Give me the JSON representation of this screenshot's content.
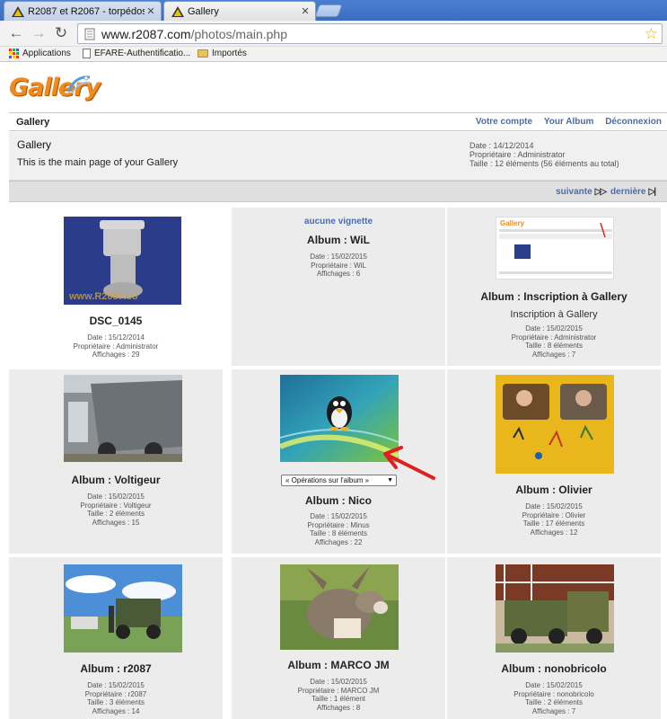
{
  "browser": {
    "tabs": [
      {
        "title": "R2087 et R2067 - torpédos,",
        "active": false
      },
      {
        "title": "Gallery",
        "active": true
      }
    ],
    "url_host": "www.r2087.com",
    "url_path": "/photos/main.php",
    "bookmarks": [
      "Applications",
      "EFARE-Authentificatio...",
      "Importés"
    ]
  },
  "gallery": {
    "logo_text": "Gallery",
    "breadcrumb": "Gallery",
    "links": {
      "account": "Votre compte",
      "album": "Your Album",
      "logout": "Déconnexion"
    },
    "info": {
      "title": "Gallery",
      "description": "This is the main page of your Gallery",
      "date": "Date : 14/12/2014",
      "owner": "Propriétaire : Administrator",
      "size": "Taille : 12 éléments (56 éléments au total)"
    },
    "pager": {
      "next": "suivante",
      "last": "dernière"
    },
    "items": [
      {
        "title": "DSC_0145",
        "meta": [
          "Date : 15/12/2014",
          "Propriétaire : Administrator",
          "Affichages : 29"
        ]
      },
      {
        "no_thumb": "aucune vignette",
        "title": "Album : WiL",
        "meta": [
          "Date : 15/02/2015",
          "Propriétaire : WiL",
          "Affichages : 6"
        ]
      },
      {
        "title": "Album : Inscription à Gallery",
        "subtitle": "Inscription à Gallery",
        "meta": [
          "Date : 15/02/2015",
          "Propriétaire : Administrator",
          "Taille : 8 éléments",
          "Affichages : 7"
        ]
      },
      {
        "title": "Album : Voltigeur",
        "meta": [
          "Date : 15/02/2015",
          "Propriétaire : Voltigeur",
          "Taille : 2 éléments",
          "Affichages : 15"
        ]
      },
      {
        "select_label": "« Opérations sur l'album »",
        "title": "Album : Nico",
        "meta": [
          "Date : 15/02/2015",
          "Propriétaire : Minus",
          "Taille : 8 éléments",
          "Affichages : 22"
        ]
      },
      {
        "title": "Album : Olivier",
        "meta": [
          "Date : 15/02/2015",
          "Propriétaire : Olivier",
          "Taille : 17 éléments",
          "Affichages : 12"
        ]
      },
      {
        "title": "Album : r2087",
        "meta": [
          "Date : 15/02/2015",
          "Propriétaire : r2087",
          "Taille : 3 éléments",
          "Affichages : 14"
        ]
      },
      {
        "title": "Album : MARCO JM",
        "meta": [
          "Date : 15/02/2015",
          "Propriétaire : MARCO JM",
          "Taille : 1 élément",
          "Affichages : 8"
        ]
      },
      {
        "title": "Album : nonobricolo",
        "meta": [
          "Date : 15/02/2015",
          "Propriétaire : nonobricolo",
          "Taille : 2 éléments",
          "Affichages : 7"
        ]
      }
    ]
  },
  "colors": {
    "link": "#4a6cb0",
    "logo": "#f08a1c",
    "cell_bg": "#ececec",
    "arrow": "#e02020"
  }
}
